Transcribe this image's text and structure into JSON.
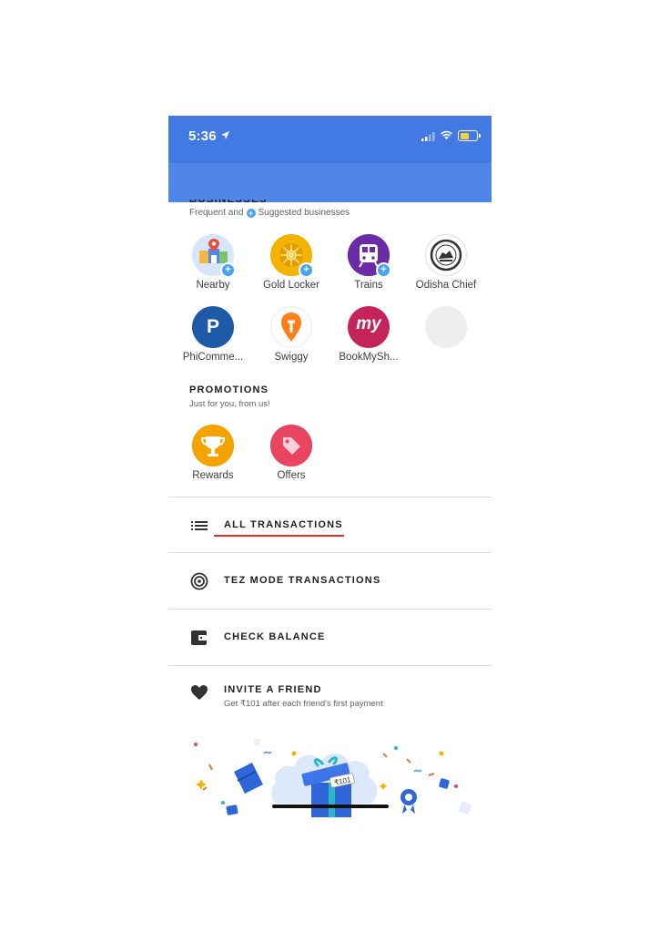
{
  "status_bar": {
    "time": "5:36"
  },
  "businesses": {
    "heading": "BUSINESSES",
    "subtitle_part1": "Frequent and",
    "subtitle_part2": "Suggested businesses",
    "items": [
      {
        "label": "Nearby",
        "icon": "nearby-store-icon"
      },
      {
        "label": "Gold Locker",
        "icon": "gold-locker-icon"
      },
      {
        "label": "Trains",
        "icon": "train-icon"
      },
      {
        "label": "Odisha Chief",
        "icon": "odisha-emblem-icon"
      },
      {
        "label": "PhiComme...",
        "icon": "phicommerce-logo"
      },
      {
        "label": "Swiggy",
        "icon": "swiggy-logo"
      },
      {
        "label": "BookMySh...",
        "icon": "bookmyshow-logo"
      },
      {
        "label": "",
        "icon": "placeholder-circle"
      }
    ],
    "logo_text": {
      "phicommerce": "P",
      "bookmyshow": "my"
    }
  },
  "promotions": {
    "heading": "PROMOTIONS",
    "subtitle": "Just for you, from us!",
    "items": [
      {
        "label": "Rewards",
        "icon": "trophy-icon"
      },
      {
        "label": "Offers",
        "icon": "tag-icon"
      }
    ]
  },
  "menu": {
    "all_transactions": "ALL TRANSACTIONS",
    "tez_mode": "TEZ MODE TRANSACTIONS",
    "check_balance": "CHECK BALANCE",
    "invite_title": "INVITE A FRIEND",
    "invite_subtitle": "Get ₹101 after each friend's first payment"
  },
  "illustration": {
    "gift_tag": "₹101"
  },
  "colors": {
    "status_bar": "#4279e3",
    "app_bar": "#4f86e8",
    "underline": "#e52d27",
    "badge": "#4aa3f0"
  }
}
